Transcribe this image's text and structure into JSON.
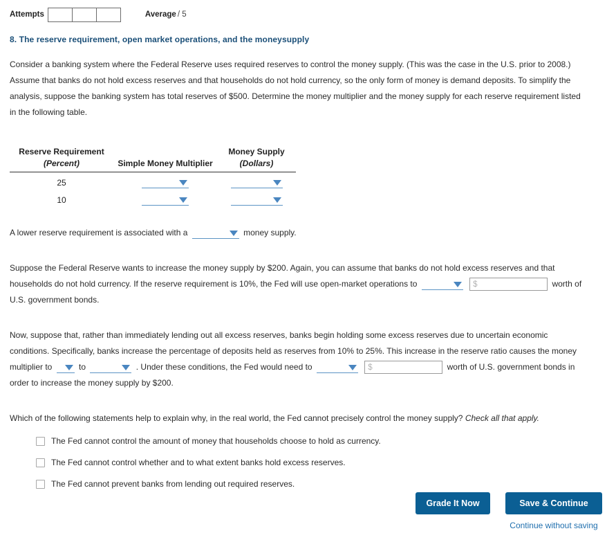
{
  "attempts": {
    "label": "Attempts",
    "boxes": [
      "",
      "",
      ""
    ],
    "average_label": "Average",
    "average_score": "/ 5"
  },
  "question": {
    "heading": "8. The reserve requirement, open market operations, and the moneysupply",
    "intro": "Consider a banking system where the Federal Reserve uses required reserves to control the money supply. (This was the case in the U.S. prior to 2008.) Assume that banks do not hold excess reserves and that households do not hold currency, so the only form of money is demand deposits. To simplify the analysis, suppose the banking system has total reserves of $500. Determine the money multiplier and the money supply for each reserve requirement listed in the following table."
  },
  "table": {
    "headers": {
      "reserve_requirement": "Reserve Requirement",
      "reserve_requirement_sub": "(Percent)",
      "simple_money_multiplier": "Simple Money Multiplier",
      "money_supply": "Money Supply",
      "money_supply_sub": "(Dollars)"
    },
    "rows": [
      {
        "reserve_requirement": "25",
        "multiplier_value": "",
        "money_supply_value": ""
      },
      {
        "reserve_requirement": "10",
        "multiplier_value": "",
        "money_supply_value": ""
      }
    ]
  },
  "statement_lower": {
    "prefix": "A lower reserve requirement is associated with a",
    "dropdown_value": "",
    "suffix": "money supply."
  },
  "paragraph_two": {
    "part1": "Suppose the Federal Reserve wants to increase the money supply by $200. Again, you can assume that banks do not hold excess reserves and that households do not hold currency. If the reserve requirement is 10%, the Fed will use open-market operations to",
    "dropdown_value": "",
    "input_value": "",
    "input_placeholder": "$",
    "part2": "worth of U.S. government bonds."
  },
  "paragraph_three": {
    "part1": "Now, suppose that, rather than immediately lending out all excess reserves, banks begin holding some excess reserves due to uncertain economic conditions. Specifically, banks increase the percentage of deposits held as reserves from 10% to 25%. This increase in the reserve ratio causes the money multiplier to",
    "dropdown_direction_value": "",
    "connector": "to",
    "dropdown_value_value": "",
    "part2": ". Under these conditions, the Fed would need to",
    "dropdown_action_value": "",
    "input_value": "",
    "input_placeholder": "$",
    "part3": "worth of U.S. government bonds in order to increase the money supply by $200."
  },
  "checkbox_question": {
    "prompt": "Which of the following statements help to explain why, in the real world, the Fed cannot precisely control the money supply?",
    "instruction": "Check all that apply.",
    "options": [
      {
        "label": "The Fed cannot control the amount of money that households choose to hold as currency.",
        "checked": false
      },
      {
        "label": "The Fed cannot control whether and to what extent banks hold excess reserves.",
        "checked": false
      },
      {
        "label": "The Fed cannot prevent banks from lending out required reserves.",
        "checked": false
      }
    ]
  },
  "actions": {
    "grade_label": "Grade It Now",
    "continue_label": "Save & Continue",
    "skip_label": "Continue without saving"
  },
  "colors": {
    "heading": "#1b4f78",
    "button": "#0b5f94",
    "link": "#1f6fae",
    "dropdown": "#4a86c0"
  }
}
